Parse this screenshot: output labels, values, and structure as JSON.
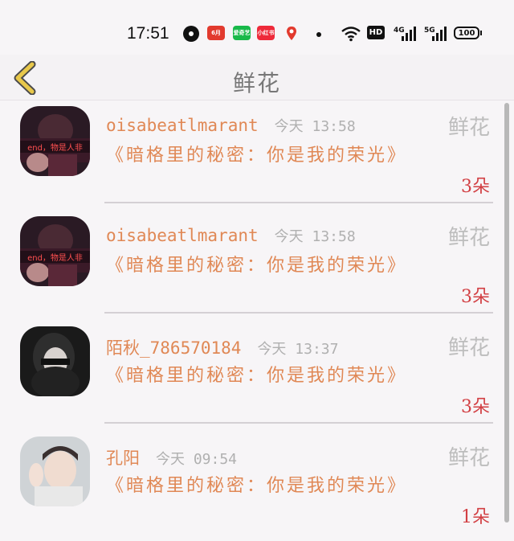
{
  "status_bar": {
    "time": "17:51",
    "app_icons": [
      {
        "name": "quark-browser-icon",
        "label": "",
        "color": "#111111"
      },
      {
        "name": "calendar-app-icon",
        "label": "6月",
        "color": "#e23a2e"
      },
      {
        "name": "iqiyi-icon",
        "label": "爱奇艺",
        "color": "#19b94a"
      },
      {
        "name": "xiaohongshu-icon",
        "label": "小红书",
        "color": "#ee2a3a"
      },
      {
        "name": "location-app-icon",
        "label": "",
        "color": "#e23a2e"
      }
    ],
    "hd_label": "HD",
    "network_1": "4G",
    "network_2": "5G",
    "battery": "100"
  },
  "header": {
    "back_icon": "chevron-left-icon",
    "title": "鲜花"
  },
  "list": [
    {
      "username": "oisabeatlmarant",
      "time": "今天 13:58",
      "gift": "鲜花",
      "message": "《暗格里的秘密：你是我的荣光》",
      "count": "3朵",
      "avatar_caption": "end，物是人非",
      "avatar": "dark-girl"
    },
    {
      "username": "oisabeatlmarant",
      "time": "今天 13:58",
      "gift": "鲜花",
      "message": "《暗格里的秘密：你是我的荣光》",
      "count": "3朵",
      "avatar_caption": "end，物是人非",
      "avatar": "dark-girl"
    },
    {
      "username": "陌秋_786570184",
      "time": "今天 13:37",
      "gift": "鲜花",
      "message": "《暗格里的秘密：你是我的荣光》",
      "count": "3朵",
      "avatar_caption": "",
      "avatar": "bw-girl"
    },
    {
      "username": "孔阳",
      "time": "今天 09:54",
      "gift": "鲜花",
      "message": "《暗格里的秘密：你是我的荣光》",
      "count": "1朵",
      "avatar_caption": "",
      "avatar": "peace-boy"
    }
  ],
  "colors": {
    "accent_text": "#e08855",
    "count_red": "#d23f43",
    "back_chevron": "#e8c84a"
  }
}
